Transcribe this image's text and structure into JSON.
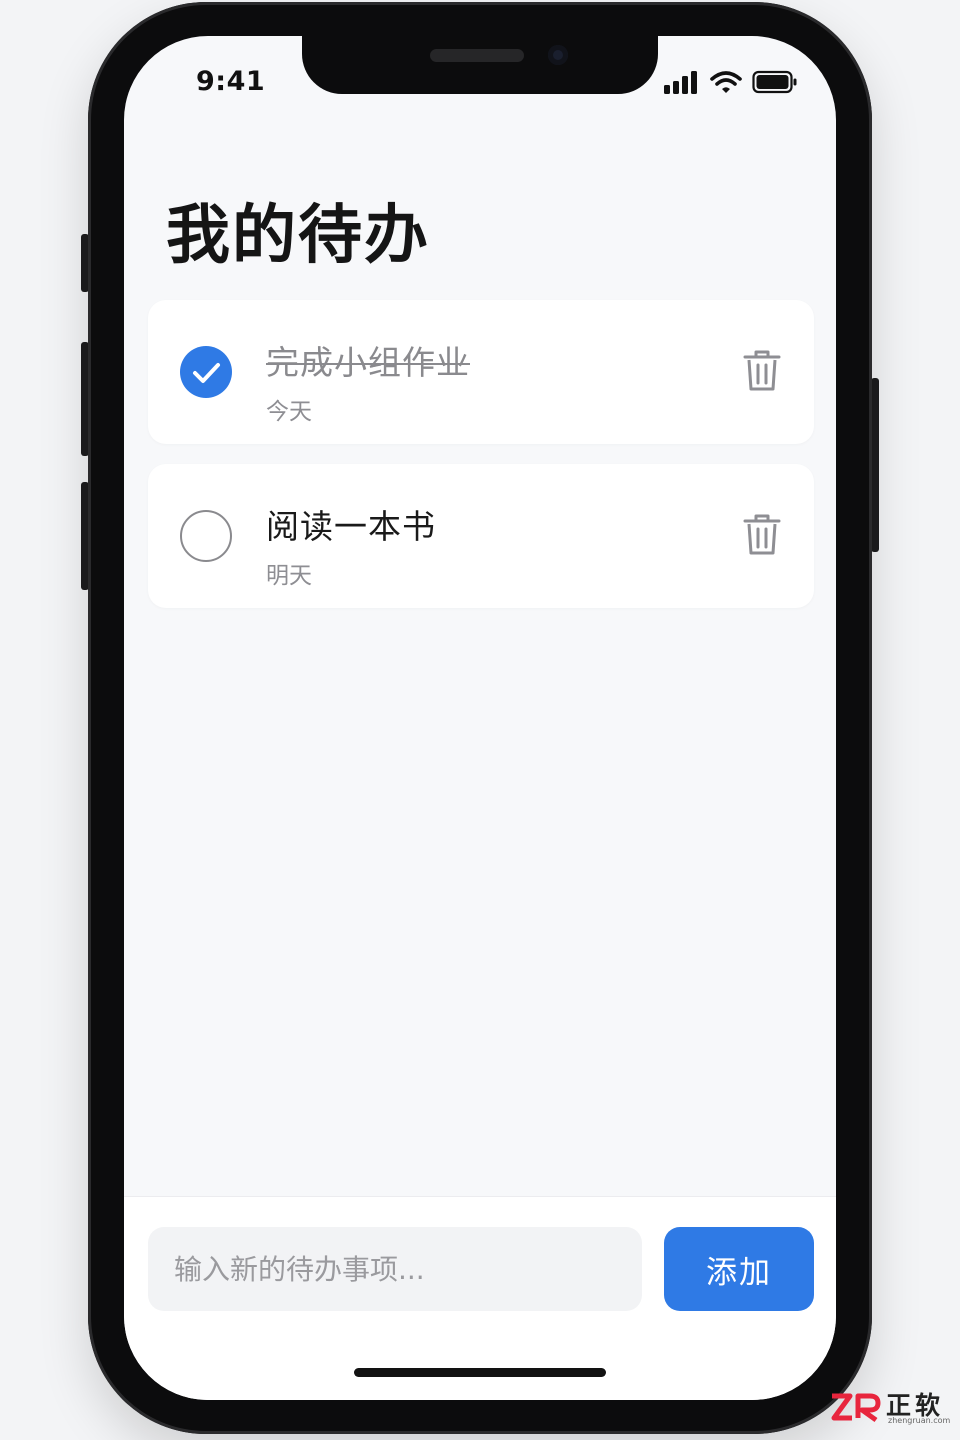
{
  "status_bar": {
    "time": "9:41"
  },
  "header": {
    "title": "我的待办"
  },
  "todos": [
    {
      "text": "完成小组作业",
      "date": "今天",
      "completed": true
    },
    {
      "text": "阅读一本书",
      "date": "明天",
      "completed": false
    }
  ],
  "input": {
    "placeholder": "输入新的待办事项...",
    "value": ""
  },
  "add_button": {
    "label": "添加"
  },
  "colors": {
    "accent": "#2f7ae5",
    "background": "#f7f8fa",
    "card": "#ffffff",
    "muted_text": "#8e8e93"
  },
  "icons": {
    "check": "checkmark-icon",
    "delete": "trash-icon",
    "signal": "signal-icon",
    "wifi": "wifi-icon",
    "battery": "battery-icon"
  },
  "watermark": {
    "brand": "正软",
    "site": "zhengruan.com"
  }
}
